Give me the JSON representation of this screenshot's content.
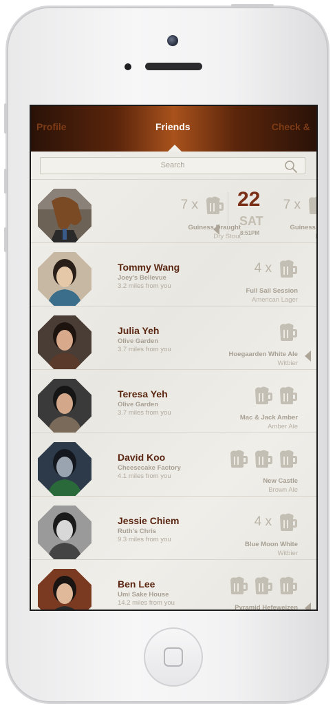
{
  "nav": {
    "left_tab": "Profile",
    "center_tab": "Friends",
    "right_tab": "Check & Rate"
  },
  "search": {
    "placeholder": "Search"
  },
  "me": {
    "count": "7 x",
    "beer": "Guiness Draught",
    "style": "Dry Stout",
    "date": {
      "day_num": "22",
      "weekday": "SAT",
      "time": "8:51PM"
    },
    "overflow": {
      "count": "7 x",
      "beer": "Guiness Draught",
      "style": "Dry Stout"
    }
  },
  "friends": [
    {
      "name": "Tommy Wang",
      "place": "Joey's Bellevue",
      "distance": "3.2 miles from you",
      "count": "4 x",
      "mugs": 1,
      "beer": "Full Sail Session",
      "style": "American Lager"
    },
    {
      "name": "Julia Yeh",
      "place": "Olive Garden",
      "distance": "3.7 miles from you",
      "count": "",
      "mugs": 1,
      "beer": "Hoegaarden White Ale",
      "style": "Witbier"
    },
    {
      "name": "Teresa Yeh",
      "place": "Olive Garden",
      "distance": "3.7 miles from you",
      "count": "",
      "mugs": 2,
      "beer": "Mac & Jack Amber",
      "style": "Amber Ale"
    },
    {
      "name": "David Koo",
      "place": "Cheesecake Factory",
      "distance": "4.1 miles from you",
      "count": "",
      "mugs": 3,
      "beer": "New Castle",
      "style": "Brown Ale"
    },
    {
      "name": "Jessie Chiem",
      "place": "Ruth's Chris",
      "distance": "9.3 miles from you",
      "count": "4 x",
      "mugs": 1,
      "beer": "Blue Moon White",
      "style": "Witbier"
    },
    {
      "name": "Ben Lee",
      "place": "Umi Sake House",
      "distance": "14.2 miles from you",
      "count": "",
      "mugs": 3,
      "beer": "Pyramid Hefeweizen",
      "style": ""
    }
  ],
  "colors": {
    "accent": "#5a2611",
    "navbar": "#a9521c",
    "mug": "#c4bfb5"
  },
  "icons": {
    "search": "search-icon",
    "mug": "beer-mug-icon",
    "chevron": "chevron-left-icon"
  }
}
